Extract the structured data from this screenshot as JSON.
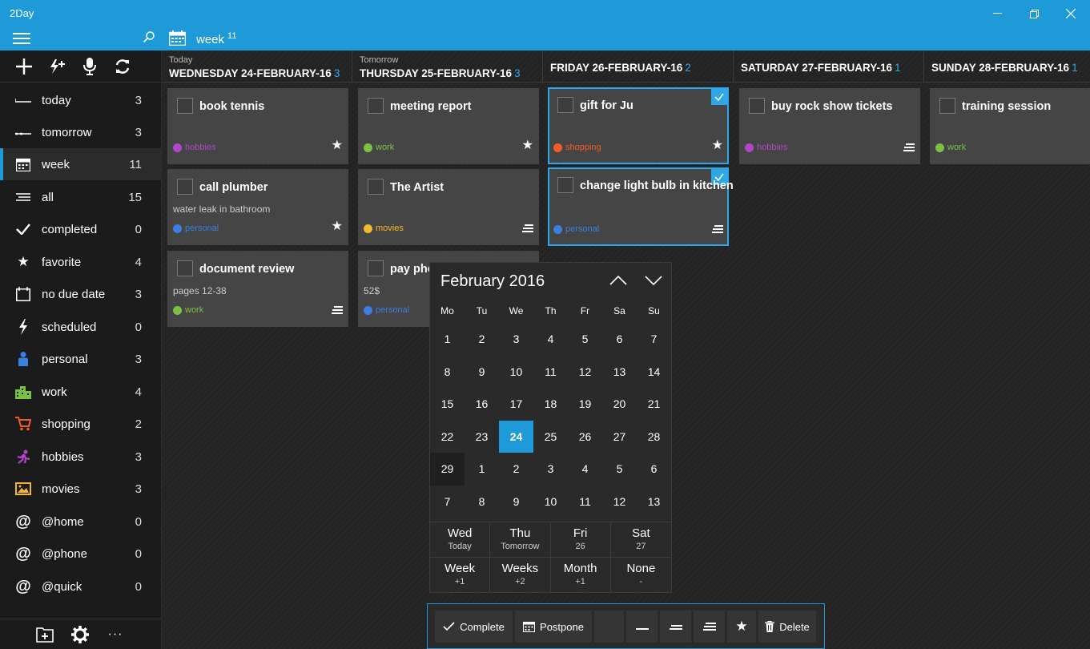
{
  "app": {
    "title": "2Day"
  },
  "window": {
    "minimize": "—",
    "maximize": "❐",
    "close": "✕"
  },
  "header": {
    "title": "week",
    "count": "11"
  },
  "sidebar": {
    "items": [
      {
        "label": "today",
        "count": "3",
        "icon": "today-icon"
      },
      {
        "label": "tomorrow",
        "count": "3",
        "icon": "tomorrow-icon"
      },
      {
        "label": "week",
        "count": "11",
        "icon": "calendar-icon"
      },
      {
        "label": "all",
        "count": "15",
        "icon": "list-icon"
      },
      {
        "label": "completed",
        "count": "0",
        "icon": "check-icon"
      },
      {
        "label": "favorite",
        "count": "4",
        "icon": "star-icon"
      },
      {
        "label": "no due date",
        "count": "3",
        "icon": "calendar-outline-icon"
      },
      {
        "label": "scheduled",
        "count": "0",
        "icon": "lightning-icon"
      },
      {
        "label": "personal",
        "count": "3",
        "icon": "person-icon"
      },
      {
        "label": "work",
        "count": "4",
        "icon": "building-icon"
      },
      {
        "label": "shopping",
        "count": "2",
        "icon": "cart-icon"
      },
      {
        "label": "hobbies",
        "count": "3",
        "icon": "runner-icon"
      },
      {
        "label": "movies",
        "count": "3",
        "icon": "picture-icon"
      },
      {
        "label": "@home",
        "count": "0",
        "icon": "at-icon"
      },
      {
        "label": "@phone",
        "count": "0",
        "icon": "at-icon"
      },
      {
        "label": "@quick",
        "count": "0",
        "icon": "at-icon"
      }
    ],
    "bottom_more": "···"
  },
  "columns": [
    {
      "sub": "Today",
      "date": "WEDNESDAY 24-FEBRUARY-16",
      "count": "3"
    },
    {
      "sub": "Tomorrow",
      "date": "THURSDAY 25-FEBRUARY-16",
      "count": "3"
    },
    {
      "sub": "",
      "date": "FRIDAY 26-FEBRUARY-16",
      "count": "2"
    },
    {
      "sub": "",
      "date": "SATURDAY 27-FEBRUARY-16",
      "count": "1"
    },
    {
      "sub": "",
      "date": "SUNDAY 28-FEBRUARY-16",
      "count": "1"
    }
  ],
  "cards": {
    "book_tennis": {
      "title": "book tennis",
      "tag": "hobbies"
    },
    "call_plumber": {
      "title": "call plumber",
      "note": "water leak in bathroom",
      "tag": "personal"
    },
    "document_review": {
      "title": "document review",
      "note": "pages 12-38",
      "tag": "work"
    },
    "meeting_report": {
      "title": "meeting report",
      "tag": "work"
    },
    "the_artist": {
      "title": "The Artist",
      "tag": "movies"
    },
    "pay_phone": {
      "title": "pay pho",
      "note": "52$",
      "tag": "personal"
    },
    "gift_for_ju": {
      "title": "gift for Ju",
      "tag": "shopping"
    },
    "change_bulb": {
      "title": "change light bulb in kitchen",
      "tag": "personal"
    },
    "rock_tickets": {
      "title": "buy rock show tickets",
      "tag": "hobbies"
    },
    "training": {
      "title": "training session",
      "tag": "work"
    }
  },
  "tag_colors": {
    "hobbies": "#b046c8",
    "personal": "#3b7fe0",
    "work": "#7cc142",
    "movies": "#f2b92e",
    "shopping": "#f25c2a"
  },
  "calendar": {
    "title": "February 2016",
    "dow": [
      "Mo",
      "Tu",
      "We",
      "Th",
      "Fr",
      "Sa",
      "Su"
    ],
    "weeks": [
      [
        "1",
        "2",
        "3",
        "4",
        "5",
        "6",
        "7"
      ],
      [
        "8",
        "9",
        "10",
        "11",
        "12",
        "13",
        "14"
      ],
      [
        "15",
        "16",
        "17",
        "18",
        "19",
        "20",
        "21"
      ],
      [
        "22",
        "23",
        "24",
        "25",
        "26",
        "27",
        "28"
      ],
      [
        "29",
        "1",
        "2",
        "3",
        "4",
        "5",
        "6"
      ],
      [
        "7",
        "8",
        "9",
        "10",
        "11",
        "12",
        "13"
      ]
    ],
    "selected": "24",
    "quick_days": [
      {
        "main": "Wed",
        "sub": "Today"
      },
      {
        "main": "Thu",
        "sub": "Tomorrow"
      },
      {
        "main": "Fri",
        "sub": "26"
      },
      {
        "main": "Sat",
        "sub": "27"
      }
    ],
    "quick_spans": [
      {
        "main": "Week",
        "sub": "+1"
      },
      {
        "main": "Weeks",
        "sub": "+2"
      },
      {
        "main": "Month",
        "sub": "+1"
      },
      {
        "main": "None",
        "sub": "-"
      }
    ]
  },
  "actions": {
    "complete": "Complete",
    "postpone": "Postpone",
    "delete": "Delete"
  },
  "accent": "#1e9ad9"
}
